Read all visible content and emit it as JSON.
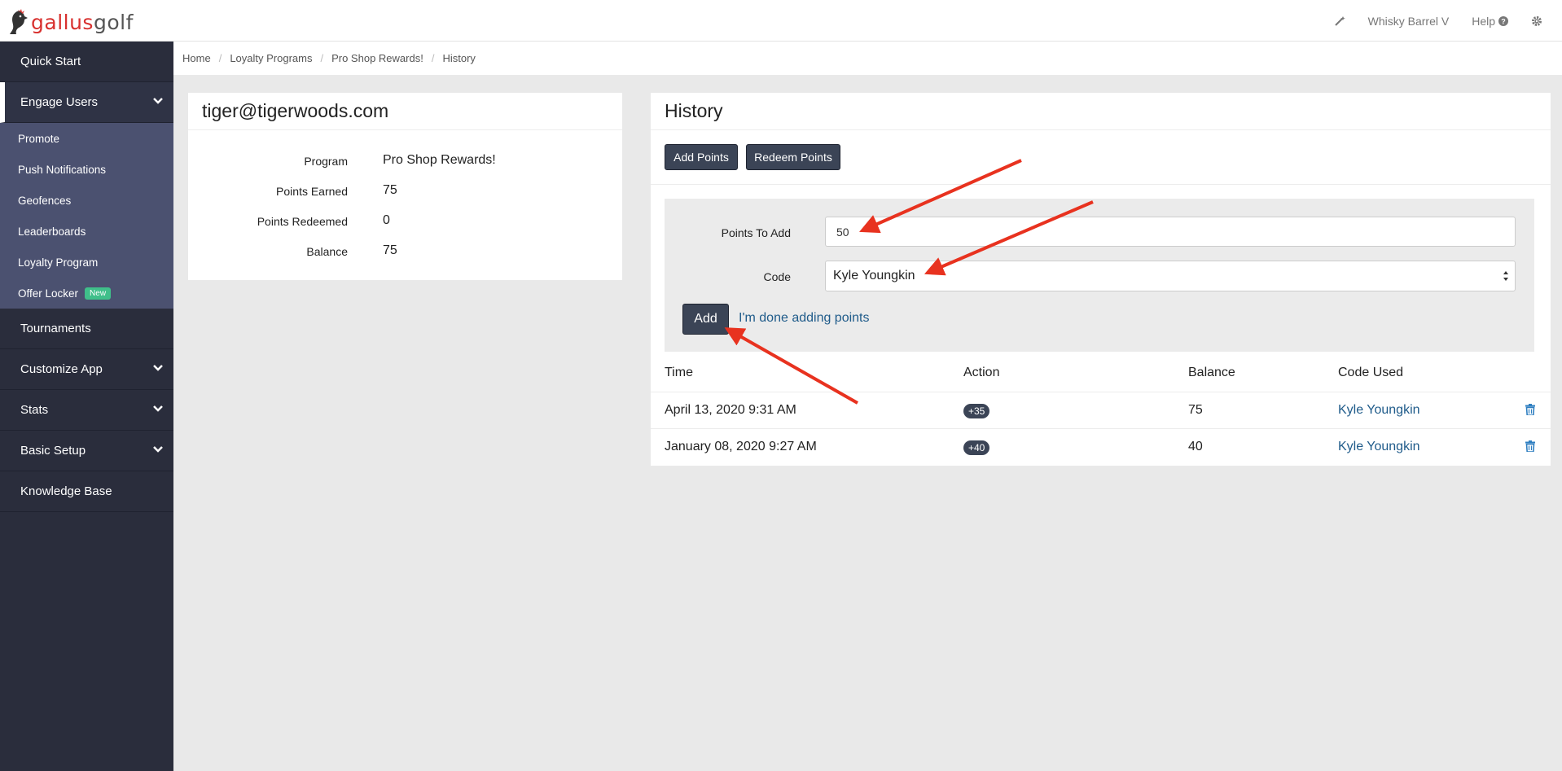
{
  "logo": {
    "part1": "gallus",
    "part2": "golf"
  },
  "top_right": {
    "account": "Whisky Barrel V",
    "help": "Help"
  },
  "sidebar": {
    "quick_start": "Quick Start",
    "engage_users": "Engage Users",
    "engage_items": [
      "Promote",
      "Push Notifications",
      "Geofences",
      "Leaderboards",
      "Loyalty Program",
      "Offer Locker"
    ],
    "new_badge": "New",
    "tournaments": "Tournaments",
    "customize_app": "Customize App",
    "stats": "Stats",
    "basic_setup": "Basic Setup",
    "knowledge_base": "Knowledge Base"
  },
  "breadcrumb": [
    "Home",
    "Loyalty Programs",
    "Pro Shop Rewards!",
    "History"
  ],
  "user_panel": {
    "email": "tiger@tigerwoods.com",
    "rows": [
      {
        "label": "Program",
        "value": "Pro Shop Rewards!"
      },
      {
        "label": "Points Earned",
        "value": "75"
      },
      {
        "label": "Points Redeemed",
        "value": "0"
      },
      {
        "label": "Balance",
        "value": "75"
      }
    ]
  },
  "history": {
    "title": "History",
    "add_points": "Add Points",
    "redeem_points": "Redeem Points",
    "form": {
      "points_label": "Points To Add",
      "points_value": "50",
      "code_label": "Code",
      "code_value": "Kyle Youngkin",
      "add_button": "Add",
      "done_link": "I'm done adding points"
    },
    "columns": [
      "Time",
      "Action",
      "Balance",
      "Code Used"
    ],
    "rows": [
      {
        "time": "April 13, 2020 9:31 AM",
        "action": "+35",
        "balance": "75",
        "code": "Kyle Youngkin"
      },
      {
        "time": "January 08, 2020 9:27 AM",
        "action": "+40",
        "balance": "40",
        "code": "Kyle Youngkin"
      }
    ]
  },
  "colors": {
    "sidebar": "#2a2d3c",
    "submenu": "#4b5170",
    "accent_red": "#e8321f",
    "button_dark": "#3b4456",
    "link": "#1f5b8a"
  }
}
